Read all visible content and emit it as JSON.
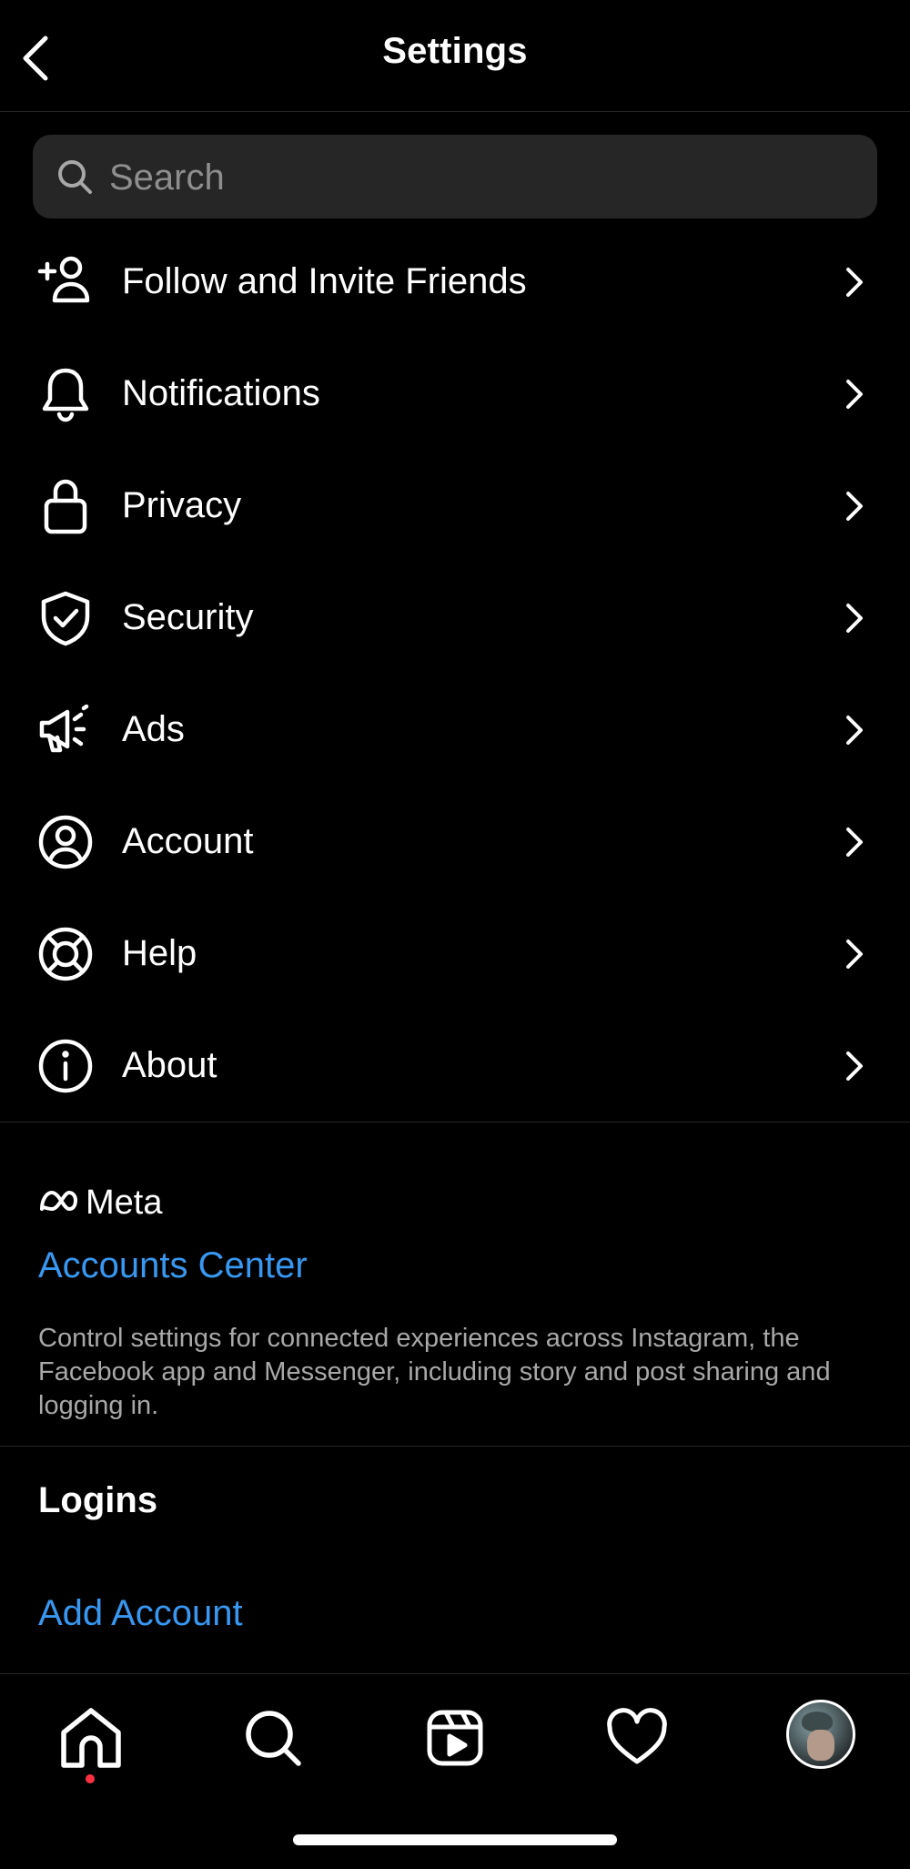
{
  "header": {
    "title": "Settings"
  },
  "search": {
    "placeholder": "Search"
  },
  "menu": {
    "items": [
      {
        "label": "Follow and Invite Friends",
        "icon": "add-person-icon"
      },
      {
        "label": "Notifications",
        "icon": "bell-icon"
      },
      {
        "label": "Privacy",
        "icon": "lock-icon"
      },
      {
        "label": "Security",
        "icon": "shield-check-icon"
      },
      {
        "label": "Ads",
        "icon": "megaphone-icon"
      },
      {
        "label": "Account",
        "icon": "person-circle-icon"
      },
      {
        "label": "Help",
        "icon": "lifebuoy-icon"
      },
      {
        "label": "About",
        "icon": "info-icon"
      }
    ]
  },
  "meta": {
    "logo_text": "Meta",
    "accounts_center": "Accounts Center",
    "description": "Control settings for connected experiences across Instagram, the Facebook app and Messenger, including story and post sharing and logging in."
  },
  "logins": {
    "heading": "Logins",
    "add_account": "Add Account"
  },
  "tabbar": {
    "tabs": [
      "home-icon",
      "search-icon",
      "reels-icon",
      "heart-icon",
      "profile-avatar"
    ],
    "notification_dot_color": "#ff3040"
  },
  "colors": {
    "background": "#000000",
    "link": "#3897f0",
    "secondary_text": "#a8a8a8",
    "search_bg": "#262626"
  }
}
